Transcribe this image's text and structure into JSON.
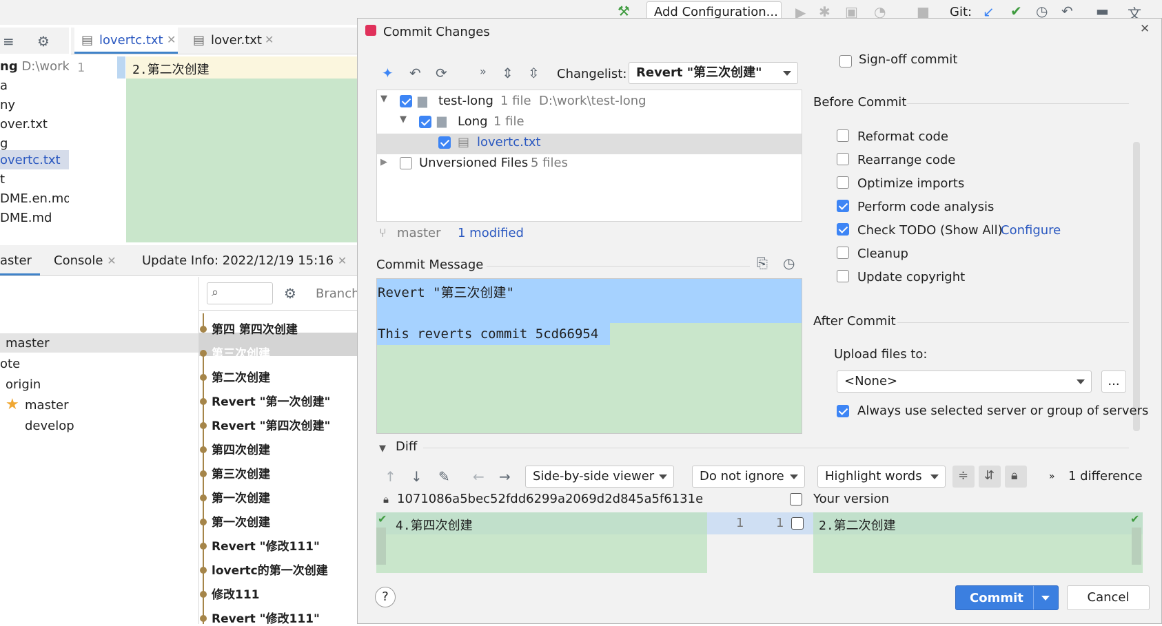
{
  "toolbar": {
    "add_configuration": "Add Configuration...",
    "git_label": "Git:"
  },
  "editor": {
    "tabs": [
      {
        "label": "lovertc.txt"
      },
      {
        "label": "lover.txt"
      }
    ],
    "line_number": "1",
    "line_text": "2.第二次创建"
  },
  "project_tree": {
    "root_partial": "ng",
    "root_path": "D:\\work\\",
    "items": [
      "a",
      "ny",
      "over.txt",
      "g",
      "overtc.txt",
      "t",
      "DME.en.md",
      "DME.md"
    ]
  },
  "bottom_panel": {
    "tabs": [
      "aster",
      "Console",
      "Update Info: 2022/12/19 15:16"
    ],
    "branch_label": "Branch:",
    "branches": [
      "master",
      "ote",
      "origin",
      "master",
      "develop"
    ],
    "commits": [
      "第四 第四次创建",
      "第三次创建",
      "第二次创建",
      "Revert \"第一次创建\"",
      "Revert \"第四次创建\"",
      "第四次创建",
      "第三次创建",
      "第一次创建",
      "第一次创建",
      "Revert \"修改111\"",
      "lovertc的第一次创建",
      "修改111",
      "Revert \"修改111\""
    ]
  },
  "dialog": {
    "title": "Commit Changes",
    "changelist_label": "Changelist:",
    "changelist_value": "Revert \"第三次创建\"",
    "tree": [
      {
        "name": "test-long",
        "meta": "1 file  D:\\work\\test-long"
      },
      {
        "name": "Long",
        "meta": "1 file"
      },
      {
        "name": "lovertc.txt",
        "meta": ""
      },
      {
        "name": "Unversioned Files",
        "meta": "5 files"
      }
    ],
    "branch": "master",
    "modified": "1 modified",
    "commit_message_label": "Commit Message",
    "commit_message_line1": "Revert \"第三次创建\"",
    "commit_message_line2": "This reverts commit 5cd66954",
    "diff_label": "Diff",
    "viewer_mode": "Side-by-side viewer",
    "ignore_mode": "Do not ignore",
    "highlight_mode": "Highlight words",
    "difference_count": "1 difference",
    "left_revision": "1071086a5bec52fdd6299a2069d2d845a5f6131e",
    "your_version": "Your version",
    "left_line_text": "4.第四次创建",
    "right_line_text": "2.第二次创建",
    "left_line_no": "1",
    "right_line_no": "1",
    "signoff": "Sign-off commit",
    "before_commit": "Before Commit",
    "options": {
      "reformat": "Reformat code",
      "rearrange": "Rearrange code",
      "optimize": "Optimize imports",
      "analysis": "Perform code analysis",
      "todo": "Check TODO (Show All)",
      "configure": "Configure",
      "cleanup": "Cleanup",
      "copyright": "Update copyright"
    },
    "after_commit": "After Commit",
    "upload_label": "Upload files to:",
    "upload_value": "<None>",
    "browse": "...",
    "always_use": "Always use selected server or group of servers",
    "commit_button": "Commit",
    "cancel_button": "Cancel",
    "help": "?"
  },
  "colors": {
    "accent": "#3d85f5",
    "diff_green": "#c9e6cb",
    "selection_blue": "#a6d2ff",
    "link": "#2a58c0"
  }
}
